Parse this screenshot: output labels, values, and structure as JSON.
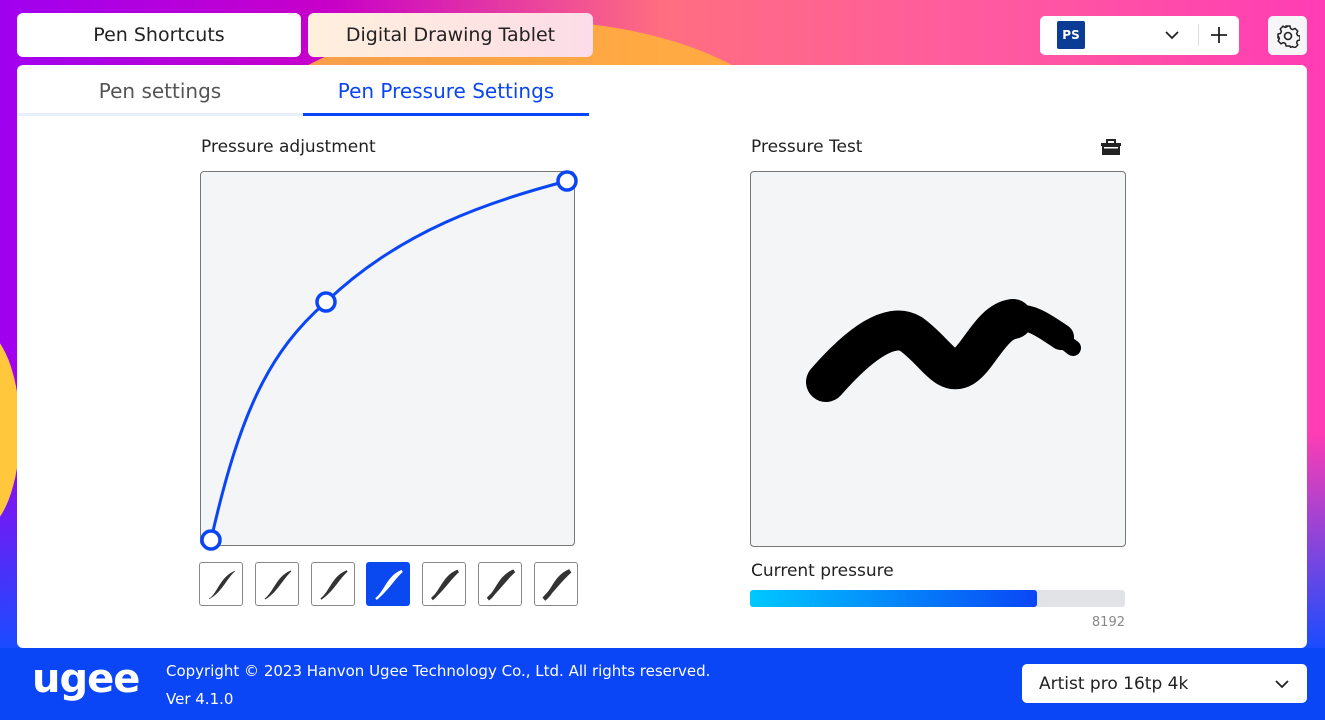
{
  "top_tabs": [
    {
      "label": "Pen Shortcuts",
      "active": true
    },
    {
      "label": "Digital Drawing Tablet",
      "active": false
    }
  ],
  "app_selector": {
    "app_icon": "PS",
    "icon_name": "photoshop-icon"
  },
  "sub_tabs": [
    {
      "label": "Pen settings",
      "active": false
    },
    {
      "label": "Pen Pressure Settings",
      "active": true
    }
  ],
  "pressure_adjustment": {
    "title": "Pressure adjustment",
    "curve_points": [
      [
        0,
        0
      ],
      [
        0.31,
        0.64
      ],
      [
        0.97,
        0.97
      ]
    ],
    "selected_preset": 3,
    "preset_count": 7
  },
  "pressure_test": {
    "title": "Pressure Test",
    "clear_icon": "eraser-basket-icon",
    "current_pressure_label": "Current pressure",
    "current_pressure_fraction": 0.765,
    "max_value": "8192"
  },
  "colors": {
    "accent": "#0a46f5",
    "bar_start": "#00c8ff",
    "bar_end": "#0a46f5"
  },
  "footer": {
    "logo": "ugee",
    "copyright": "Copyright © 2023 Hanvon Ugee Technology Co., Ltd. All rights reserved.",
    "version": "Ver 4.1.0",
    "device": "Artist pro 16tp 4k"
  }
}
